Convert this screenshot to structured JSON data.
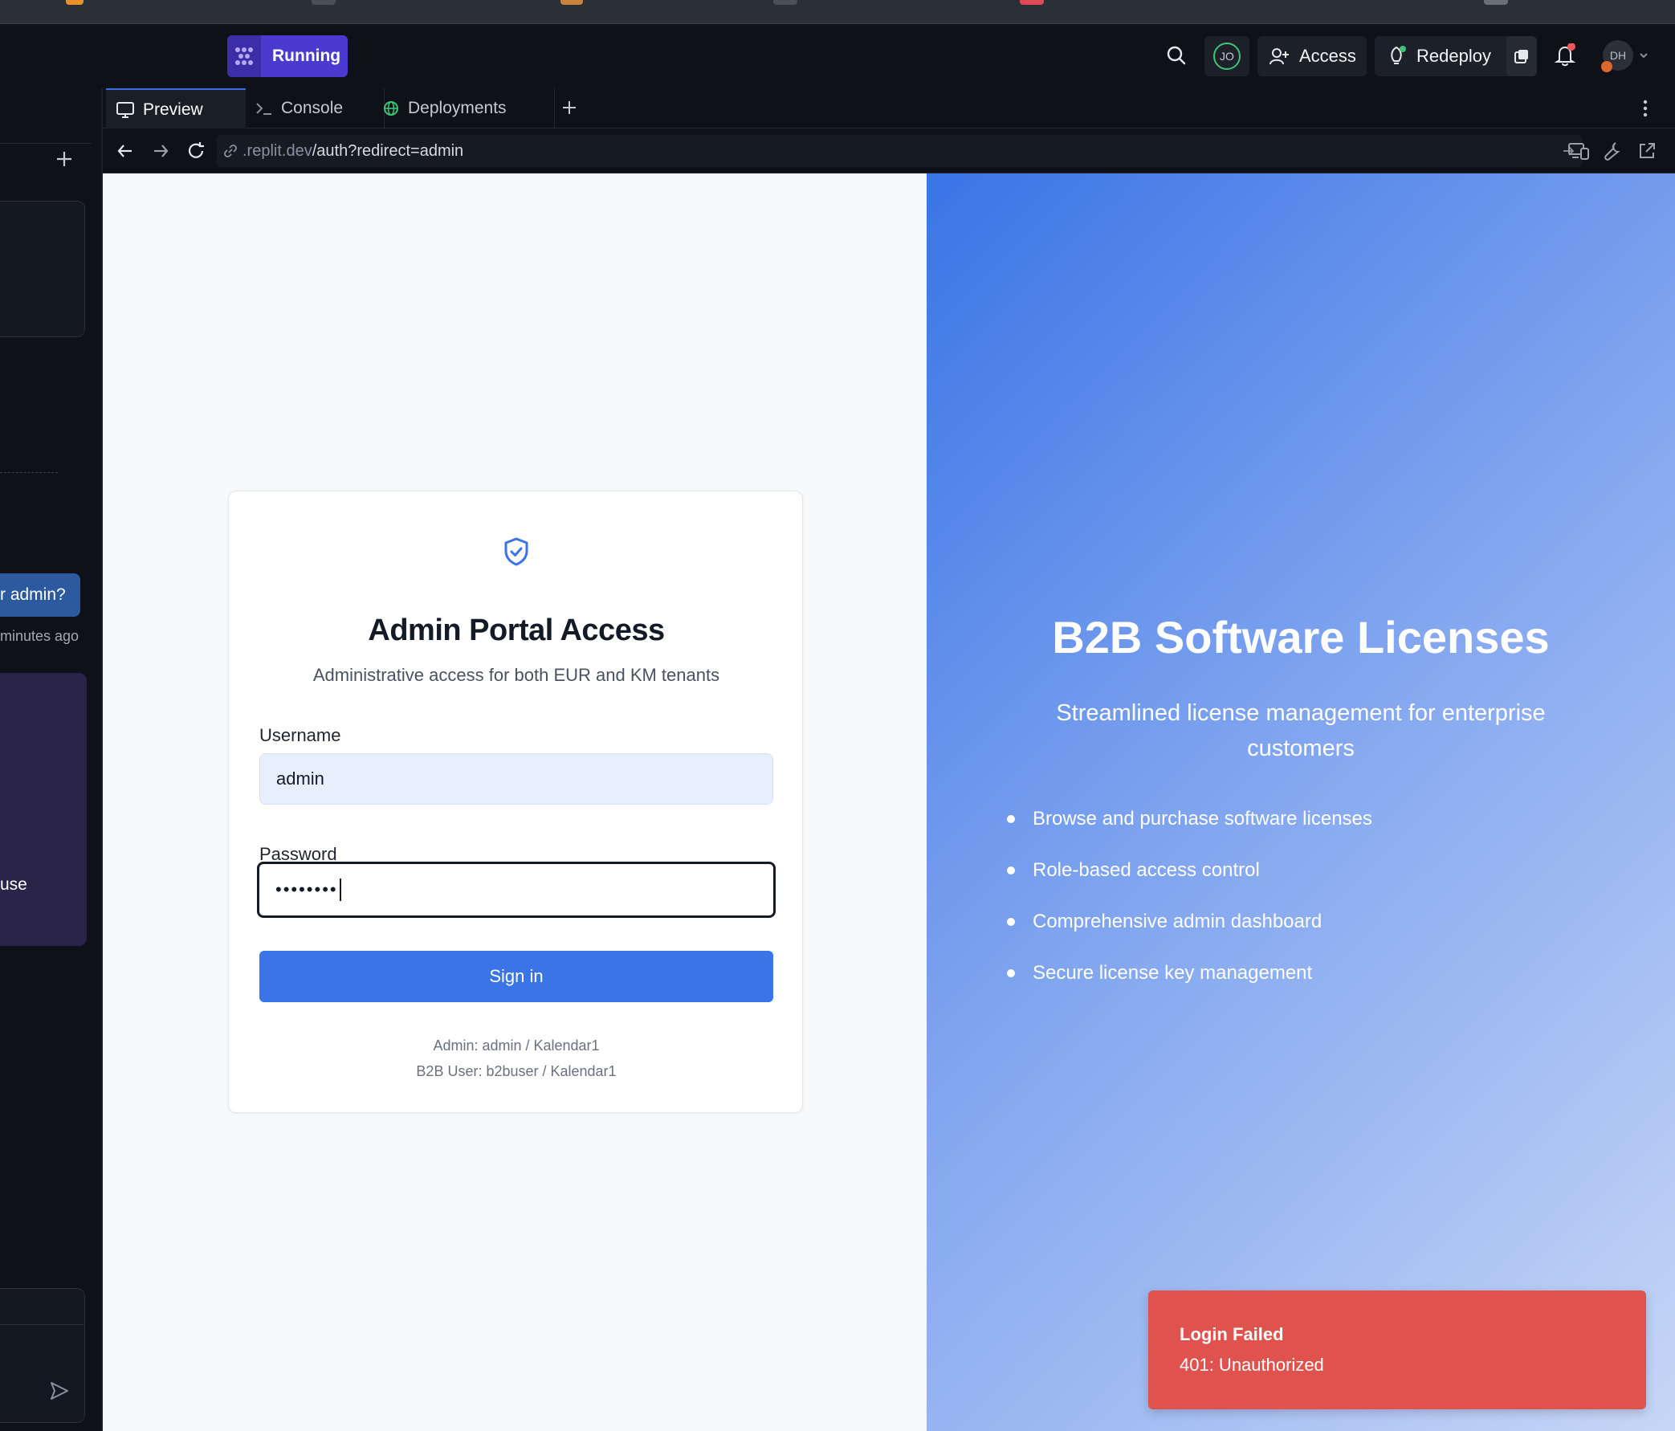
{
  "header": {
    "run_label": "Running",
    "avatar_initials": "JO",
    "access_label": "Access",
    "redeploy_label": "Redeploy",
    "user_initials": "DH"
  },
  "sidebar": {
    "msg_bubble": "r admin?",
    "msg_time": "minutes ago",
    "panel_text": "use"
  },
  "tabs": [
    {
      "label": "Preview"
    },
    {
      "label": "Console"
    },
    {
      "label": "Deployments"
    }
  ],
  "url": {
    "domain": ".replit.dev",
    "path": "/auth?redirect=admin"
  },
  "login": {
    "title": "Admin Portal Access",
    "subtitle": "Administrative access for both EUR and KM tenants",
    "username_label": "Username",
    "username_value": "admin",
    "password_label": "Password",
    "password_value": "••••••••",
    "signin_label": "Sign in",
    "hint_admin": "Admin: admin / Kalendar1",
    "hint_b2b": "B2B User: b2buser / Kalendar1"
  },
  "hero": {
    "title": "B2B Software Licenses",
    "subtitle": "Streamlined license management for enterprise customers",
    "features": [
      "Browse and purchase software licenses",
      "Role-based access control",
      "Comprehensive admin dashboard",
      "Secure license key management"
    ]
  },
  "toast": {
    "title": "Login Failed",
    "message": "401: Unauthorized"
  },
  "colors": {
    "accent": "#3a74e6",
    "running": "#4a3ad0",
    "toast": "#e0524e"
  }
}
